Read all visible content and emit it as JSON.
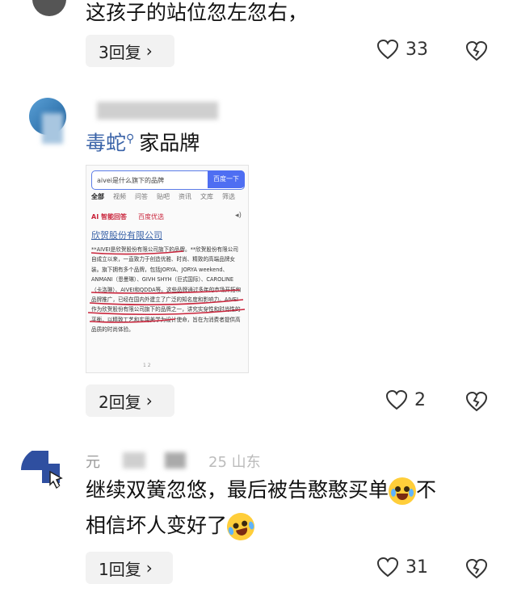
{
  "comments": [
    {
      "text": "这孩子的站位忽左忽右，",
      "reply_label": "3回复",
      "likes": "33"
    },
    {
      "brand_link": "毒蛇",
      "text_tail": "家品牌",
      "reply_label": "2回复",
      "likes": "2",
      "screenshot": {
        "search_query": "aivei是什么旗下的品牌",
        "search_button": "百度一下",
        "tabs": [
          "全部",
          "视频",
          "问答",
          "贴吧",
          "资讯",
          "文库",
          "筛选"
        ],
        "source_badge": "AI 智能回答",
        "source_badge2": "百度优选",
        "answer_title": "欣贺股份有限公司",
        "answer_body": "**AIVEI是欣贺股份有限公司旗下的品牌。**欣贺股份有限公司自成立以来，一直致力于创造优雅、时尚、精致的高端品牌女装。旗下拥有多个品牌，包括JORYA、JORYA weekend、ANMANI（恩曼琳）、GIVH SHYH（巨式国际）、CAROLINE（卡洛琳）、AIVEI和QDDA等。这些品牌通过多年的市场开拓和品牌推广，已经在国内外建立了广泛的知名度和影响力。AIVEI作为欣贺股份有限公司旗下的品牌之一，讲究实穿性和时尚性的平衡，以精致工艺和实用美学为设计使命，旨在为消费者提供高品质的时尚体验。",
        "page_nums": "1 2"
      }
    },
    {
      "username": "元",
      "meta_tail": "25 山东",
      "text_line1": "继续双簧忽悠，最后被告憨憨买单",
      "text_line1_tail": "不",
      "text_line2": "相信坏人变好了",
      "reply_label": "1回复",
      "likes": "31"
    }
  ],
  "colors": {
    "link_blue": "#3a63a8",
    "pill_bg": "#f2f2f2",
    "underline_red": "#c9243b"
  },
  "icons": {
    "heart": "heart-icon",
    "dislike": "broken-heart-icon",
    "chevron": "chevron-right-icon",
    "search": "search-icon"
  }
}
